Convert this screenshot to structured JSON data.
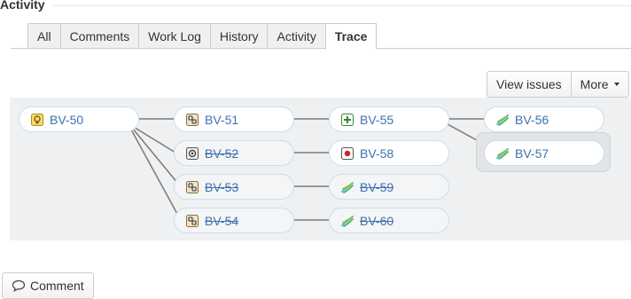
{
  "section": {
    "title": "Activity"
  },
  "tabs": [
    {
      "label": "All",
      "active": false
    },
    {
      "label": "Comments",
      "active": false
    },
    {
      "label": "Work Log",
      "active": false
    },
    {
      "label": "History",
      "active": false
    },
    {
      "label": "Activity",
      "active": false
    },
    {
      "label": "Trace",
      "active": true
    }
  ],
  "toolbar": {
    "view_issues_label": "View issues",
    "more_label": "More"
  },
  "trace": {
    "nodes": [
      {
        "key": "BV-50",
        "icon": "bulb-icon",
        "resolved": false,
        "selected": false
      },
      {
        "key": "BV-51",
        "icon": "linked-task-icon",
        "resolved": false,
        "selected": false
      },
      {
        "key": "BV-52",
        "icon": "target-icon",
        "resolved": true,
        "selected": false
      },
      {
        "key": "BV-53",
        "icon": "linked-task-icon",
        "resolved": true,
        "selected": false
      },
      {
        "key": "BV-54",
        "icon": "linked-task-icon",
        "resolved": true,
        "selected": false
      },
      {
        "key": "BV-55",
        "icon": "plus-square-icon",
        "resolved": false,
        "selected": false
      },
      {
        "key": "BV-58",
        "icon": "red-dot-icon",
        "resolved": false,
        "selected": false
      },
      {
        "key": "BV-59",
        "icon": "feather-icon",
        "resolved": true,
        "selected": false
      },
      {
        "key": "BV-60",
        "icon": "feather-icon",
        "resolved": true,
        "selected": false
      },
      {
        "key": "BV-56",
        "icon": "feather-icon",
        "resolved": false,
        "selected": false
      },
      {
        "key": "BV-57",
        "icon": "feather-icon",
        "resolved": false,
        "selected": true
      }
    ]
  },
  "colors": {
    "link": "#3b73af",
    "node_border": "#c9dff0",
    "panel_bg": "#eff0f1",
    "connector": "#7a7a7a"
  },
  "comment_button": {
    "label": "Comment",
    "icon": "speech-bubble-icon"
  }
}
